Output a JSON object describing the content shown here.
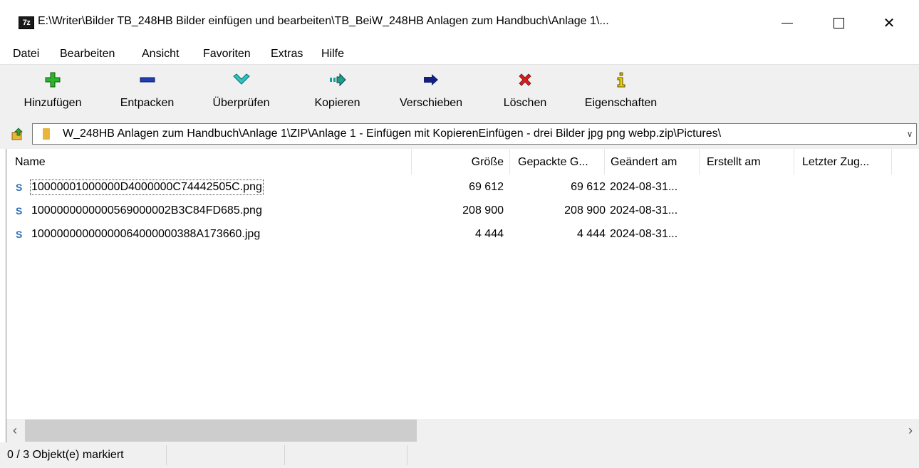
{
  "window": {
    "app_icon_text": "7z",
    "title": "E:\\Writer\\Bilder TB_248HB Bilder einfügen und bearbeiten\\TB_BeiW_248HB Anlagen zum Handbuch\\Anlage 1\\...",
    "close_symbol": "✕"
  },
  "menu": {
    "items": [
      "Datei",
      "Bearbeiten",
      "Ansicht",
      "Favoriten",
      "Extras",
      "Hilfe"
    ]
  },
  "toolbar": {
    "buttons": [
      {
        "label": "Hinzufügen",
        "icon": "plus-icon"
      },
      {
        "label": "Entpacken",
        "icon": "minus-icon"
      },
      {
        "label": "Überprüfen",
        "icon": "check-icon"
      },
      {
        "label": "Kopieren",
        "icon": "copy-arrow-icon"
      },
      {
        "label": "Verschieben",
        "icon": "move-arrow-icon"
      },
      {
        "label": "Löschen",
        "icon": "delete-x-icon"
      },
      {
        "label": "Eigenschaften",
        "icon": "info-icon"
      }
    ],
    "colors": {
      "add": "#2cb52c",
      "extract": "#1f3fb8",
      "test": "#2ec4c4",
      "copy": "#1a9e8f",
      "move": "#14207a",
      "delete": "#d81e1e",
      "info": "#c9a400"
    }
  },
  "address": {
    "path": "W_248HB Anlagen zum Handbuch\\Anlage 1\\ZIP\\Anlage 1 - Einfügen mit KopierenEinfügen - drei Bilder jpg png webp.zip\\Pictures\\",
    "dropdown_symbol": "∨"
  },
  "list": {
    "columns": [
      "Name",
      "Größe",
      "Gepackte G...",
      "Geändert am",
      "Erstellt am",
      "Letzter Zug..."
    ],
    "rows": [
      {
        "name": "10000001000000D4000000C74442505C.png",
        "size": "69 612",
        "packed": "69 612",
        "modified": "2024-08-31..."
      },
      {
        "name": "1000000000000569000002B3C84FD685.png",
        "size": "208 900",
        "packed": "208 900",
        "modified": "2024-08-31..."
      },
      {
        "name": "10000000000000064000000388A173660.jpg",
        "size": "4 444",
        "packed": "4 444",
        "modified": "2024-08-31..."
      }
    ],
    "file_icon_glyph": "S"
  },
  "scrollbar": {
    "left_symbol": "‹",
    "right_symbol": "›"
  },
  "status": {
    "text": "0 / 3 Objekt(e) markiert"
  }
}
